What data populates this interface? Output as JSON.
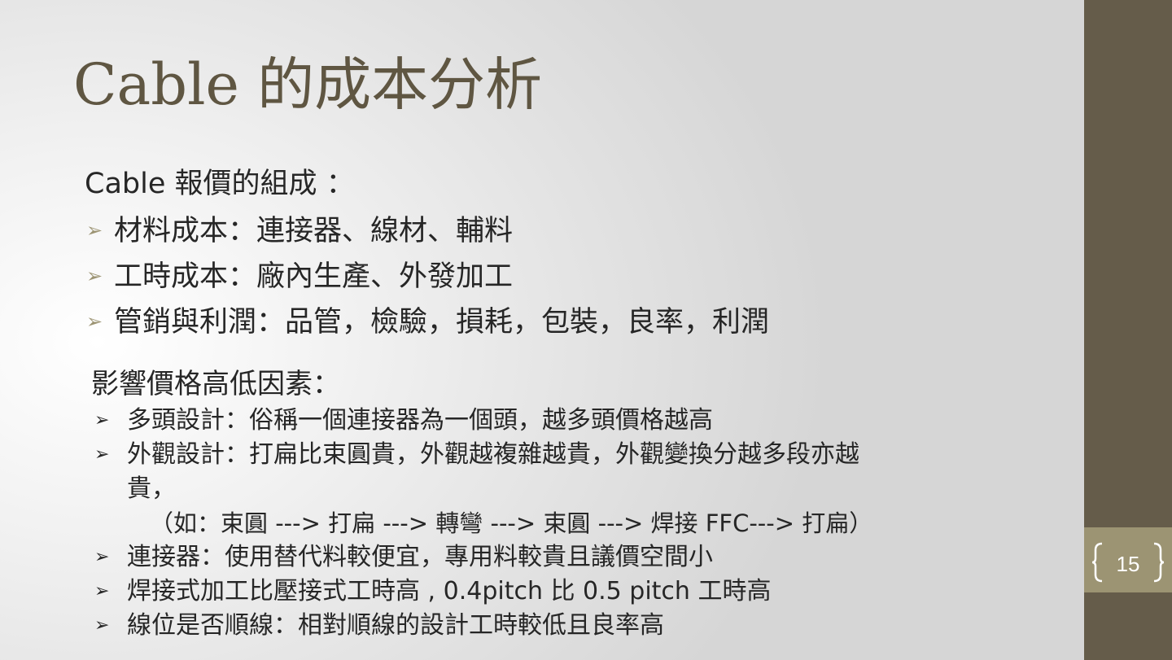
{
  "title": "Cable 的成本分析",
  "section1": {
    "heading": "Cable 報價的組成 ：",
    "items": [
      "材料成本：連接器、線材、輔料",
      "工時成本：廠內生產、外發加工",
      "管銷與利潤：品管，檢驗，損耗，包裝，良率，利潤"
    ]
  },
  "section2": {
    "heading": "影響價格高低因素：",
    "items": [
      {
        "text": "多頭設計：俗稱一個連接器為一個頭，越多頭價格越高"
      },
      {
        "text": "外觀設計：打扁比束圓貴，外觀越複雜越貴，外觀變換分越多段亦越",
        "continuation": "貴，",
        "example": "（如：束圓 ---> 打扁 ---> 轉彎 ---> 束圓 ---> 焊接 FFC---> 打扁）"
      },
      {
        "text": "連接器：使用替代料較便宜，專用料較貴且議價空間小"
      },
      {
        "text": "焊接式加工比壓接式工時高 , 0.4pitch  比 0.5 pitch  工時高"
      },
      {
        "text": "線位是否順線：相對順線的設計工時較低且良率高"
      }
    ]
  },
  "page_number": "15",
  "colors": {
    "sidebar": "#655c4a",
    "page_box": "#9c9473",
    "title_text": "#5f5642",
    "body_text": "#262626",
    "bullet_accent": "#9c9473"
  },
  "icons": {
    "bullet": "arrowhead-bullet-icon",
    "page_frame": "bracket-frame-icon"
  }
}
